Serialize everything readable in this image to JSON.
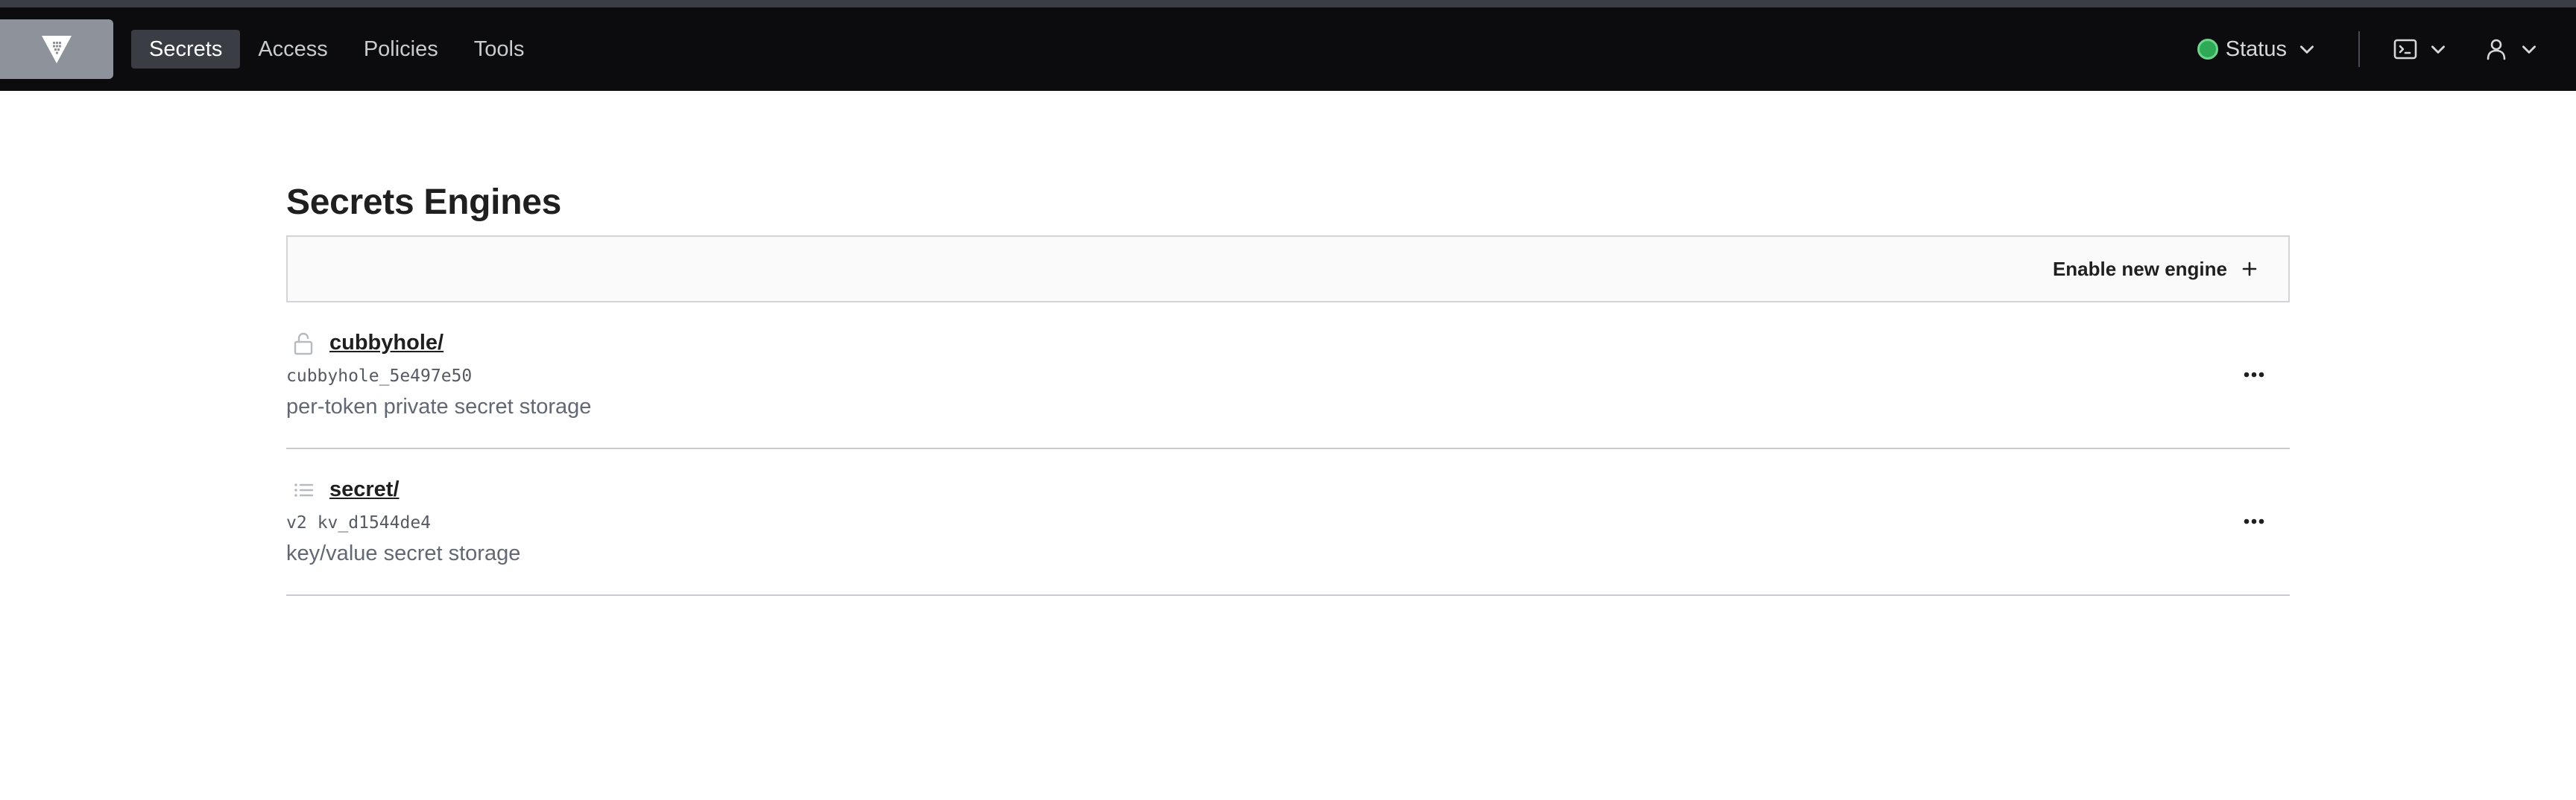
{
  "nav": {
    "items": [
      {
        "label": "Secrets",
        "active": true
      },
      {
        "label": "Access",
        "active": false
      },
      {
        "label": "Policies",
        "active": false
      },
      {
        "label": "Tools",
        "active": false
      }
    ]
  },
  "header": {
    "status_label": "Status",
    "status_color": "#2ea956",
    "console_icon": "terminal-icon",
    "user_icon": "user-icon"
  },
  "main": {
    "title": "Secrets Engines",
    "enable_button_label": "Enable new engine"
  },
  "engines": [
    {
      "name": "cubbyhole/",
      "icon": "lock-icon",
      "version": "",
      "accessor": "cubbyhole_5e497e50",
      "description": "per-token private secret storage"
    },
    {
      "name": "secret/",
      "icon": "list-icon",
      "version": "v2",
      "accessor": "kv_d1544de4",
      "description": "key/value secret storage"
    }
  ]
}
